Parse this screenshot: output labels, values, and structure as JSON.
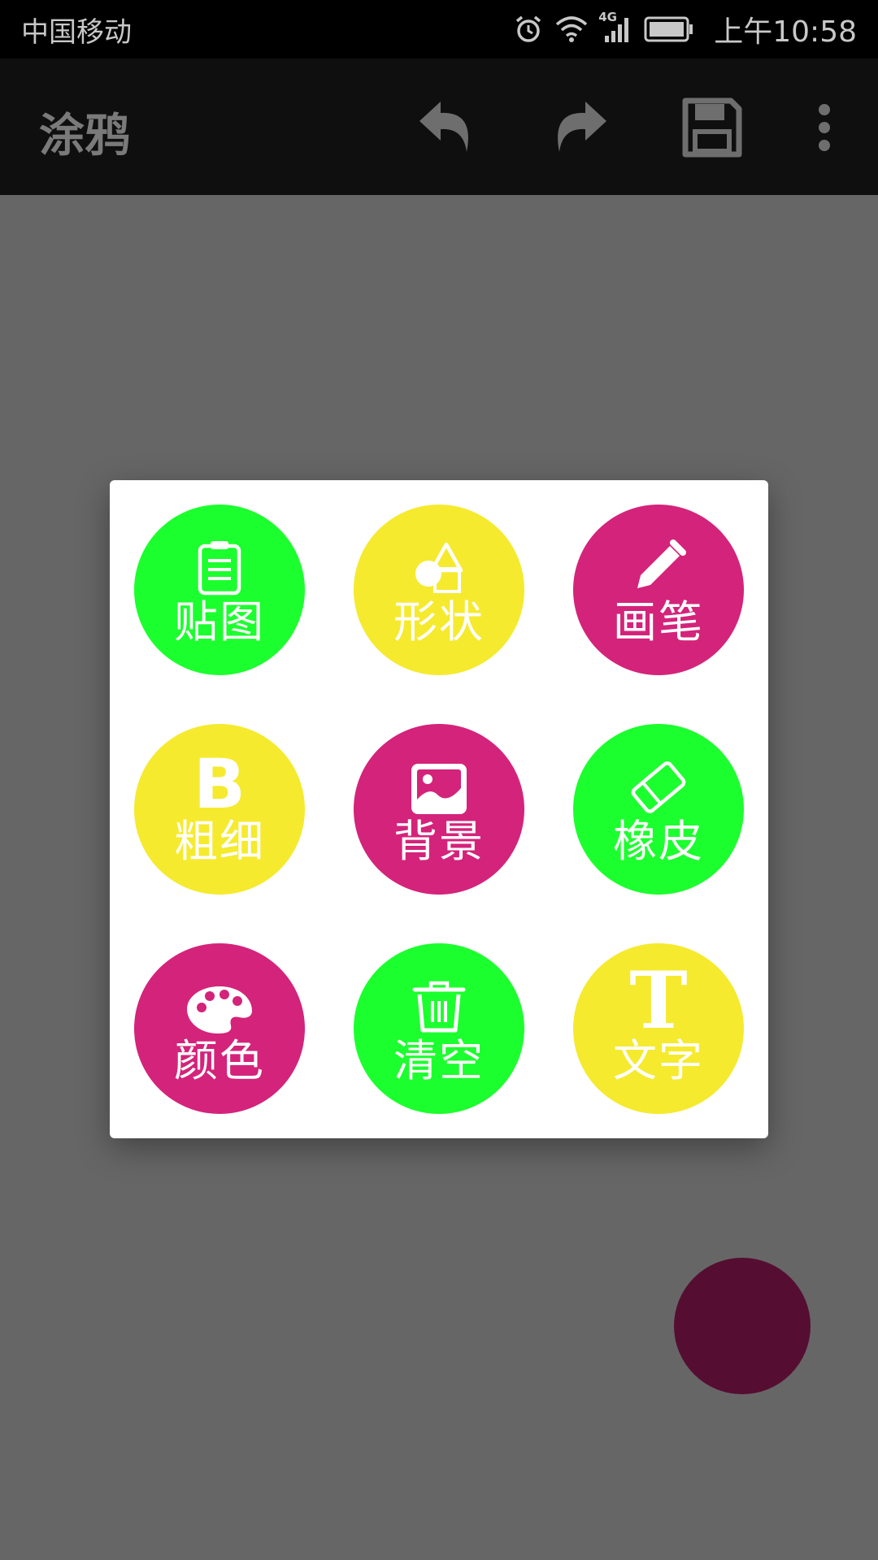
{
  "status_bar": {
    "carrier": "中国移动",
    "network": "4G",
    "time": "上午10:58",
    "icons": [
      "alarm-icon",
      "wifi-icon",
      "signal-icon",
      "battery-icon"
    ]
  },
  "app_bar": {
    "title": "涂鸦",
    "actions": [
      "undo-icon",
      "redo-icon",
      "save-icon",
      "more-vert-icon"
    ]
  },
  "colors": {
    "green": "#1cff2e",
    "yellow": "#f5ea2e",
    "magenta": "#d4237a",
    "current_paint": "#550e31"
  },
  "tools": [
    {
      "label": "贴图",
      "icon": "clipboard-icon",
      "color": "#1cff2e"
    },
    {
      "label": "形状",
      "icon": "shapes-icon",
      "color": "#f5ea2e"
    },
    {
      "label": "画笔",
      "icon": "pencil-icon",
      "color": "#d4237a"
    },
    {
      "label": "粗细",
      "icon": "bold-icon",
      "color": "#f5ea2e",
      "glyph": "B"
    },
    {
      "label": "背景",
      "icon": "image-icon",
      "color": "#d4237a"
    },
    {
      "label": "橡皮",
      "icon": "eraser-icon",
      "color": "#1cff2e"
    },
    {
      "label": "颜色",
      "icon": "palette-icon",
      "color": "#d4237a"
    },
    {
      "label": "清空",
      "icon": "trash-icon",
      "color": "#1cff2e"
    },
    {
      "label": "文字",
      "icon": "text-icon",
      "color": "#f5ea2e",
      "glyph": "T"
    }
  ]
}
